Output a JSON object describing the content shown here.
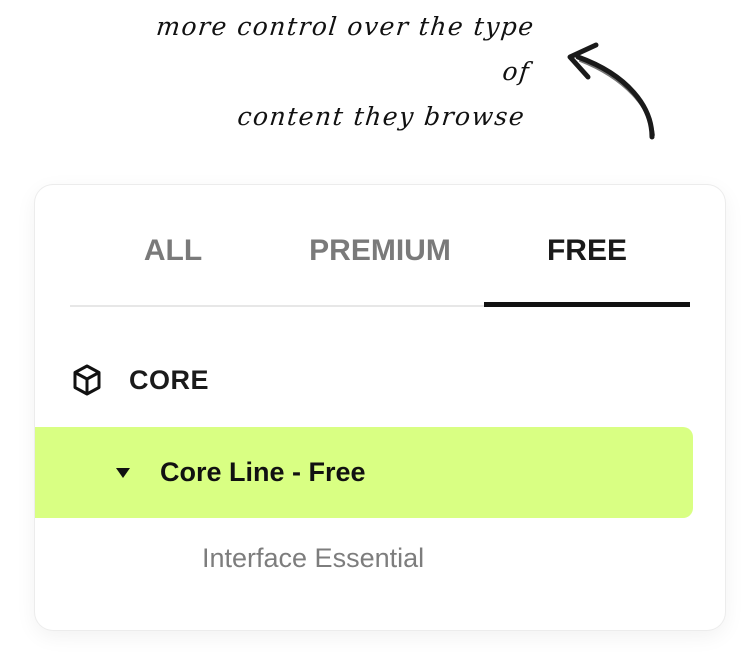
{
  "annotation": {
    "line1": "more control over the type of",
    "line2": "content they browse",
    "arrow_icon": "hand-drawn-curved-arrow-icon"
  },
  "tabs": [
    {
      "label": "ALL",
      "selected": false
    },
    {
      "label": "PREMIUM",
      "selected": false
    },
    {
      "label": "FREE",
      "selected": true
    }
  ],
  "section": {
    "title": "CORE",
    "icon": "cube-icon"
  },
  "tree": {
    "active_item": {
      "label": "Core Line - Free",
      "expanded": true,
      "icon": "caret-down-icon"
    },
    "children": [
      {
        "label": "Interface Essential"
      }
    ]
  },
  "colors": {
    "highlight": "#d9ff83",
    "text_primary": "#1a1a1a",
    "text_muted": "#7a7a7a",
    "tab_underline": "#111111",
    "divider": "#e7e7e7"
  }
}
